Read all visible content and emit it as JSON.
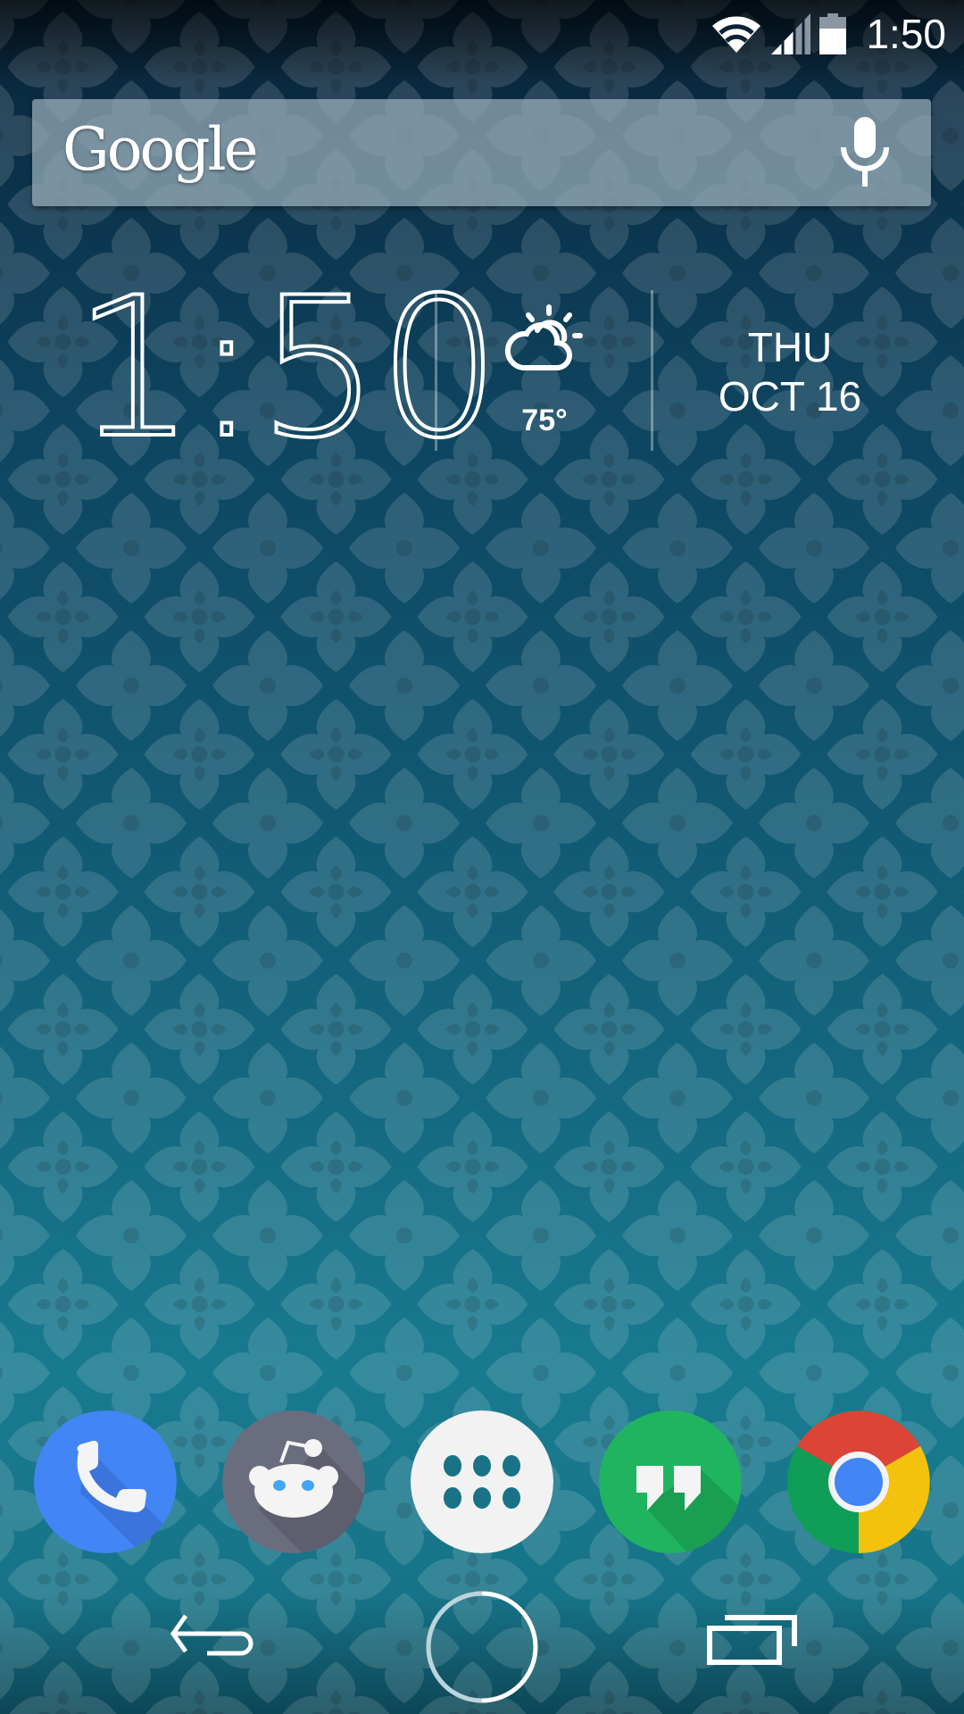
{
  "status_bar": {
    "time": "1:50",
    "icons": [
      "wifi-icon",
      "cell-signal-icon",
      "battery-icon"
    ]
  },
  "search_widget": {
    "logo_text": "Google",
    "voice_icon": "mic-icon"
  },
  "clock_widget": {
    "time": "1:50",
    "weather": {
      "icon": "partly-cloudy-icon",
      "temperature": "75°"
    },
    "day": "THU",
    "date": "OCT 16"
  },
  "dock": {
    "apps": [
      {
        "name": "Phone",
        "icon": "phone-icon",
        "color": "#4285f4"
      },
      {
        "name": "Reddit",
        "icon": "reddit-icon",
        "color": "#6a6d7e"
      },
      {
        "name": "Apps",
        "icon": "app-drawer-icon",
        "color": "#f2f2f2"
      },
      {
        "name": "Hangouts",
        "icon": "hangouts-icon",
        "color": "#20b460"
      },
      {
        "name": "Chrome",
        "icon": "chrome-icon",
        "color": "#db4437"
      }
    ]
  },
  "nav_bar": {
    "buttons": [
      "back",
      "home",
      "recents"
    ]
  },
  "theme": {
    "wallpaper_dark": "#0f5670",
    "wallpaper_motif": "#2a93a8"
  }
}
